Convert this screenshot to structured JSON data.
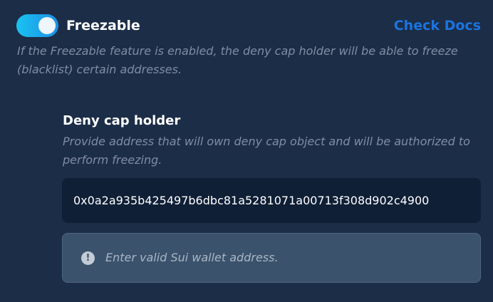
{
  "freezable": {
    "title": "Freezable",
    "toggle_on": true,
    "docs_link": "Check Docs",
    "description": "If the Freezable feature is enabled, the deny cap holder will be able to freeze (blacklist) certain addresses."
  },
  "deny_cap": {
    "label": "Deny cap holder",
    "description": "Provide address that will own deny cap object and will be authorized to perform freezing.",
    "address_value": "0x0a2a935b425497b6dbc81a5281071a00713f308d902c4900"
  },
  "error": {
    "icon": "alert-circle-icon",
    "message": "Enter valid Sui wallet address."
  },
  "colors": {
    "background": "#1c2d47",
    "accent": "#1a74e0",
    "toggle_start": "#19c3f0",
    "toggle_end": "#1f8de6",
    "input_bg": "#0f1f36",
    "error_bg": "#3a526c"
  }
}
